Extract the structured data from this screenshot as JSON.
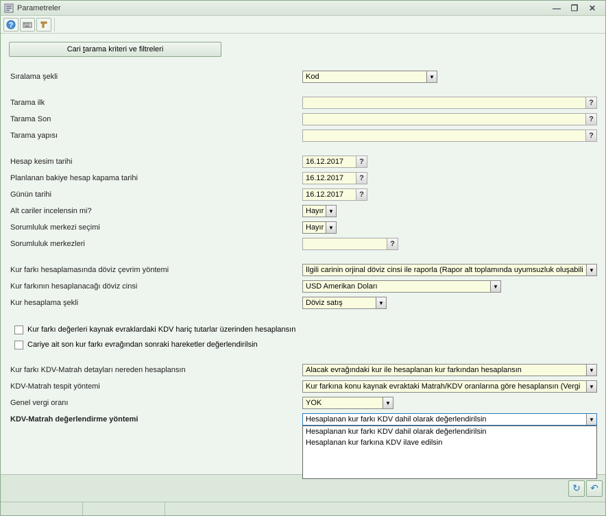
{
  "window": {
    "title": "Parametreler"
  },
  "buttons": {
    "filterBtn_pre": "Cari ",
    "filterBtn_u": "t",
    "filterBtn_post": "arama kriteri ve filtreleri"
  },
  "labels": {
    "sortType": "Sıralama şekli",
    "scanFirst": "Tarama ilk",
    "scanLast": "Tarama Son",
    "scanStruct": "Tarama yapısı",
    "accCutoff": "Hesap kesim tarihi",
    "plannedClose": "Planlanan bakiye hesap kapama tarihi",
    "todayDate": "Günün tarihi",
    "subAccounts": "Alt cariler incelensin mi?",
    "respCenterSel": "Sorumluluk merkezi seçimi",
    "respCenters": "Sorumluluk merkezleri",
    "fxConvMethod": "Kur farkı hesaplamasında döviz çevrim yöntemi",
    "fxCurrency": "Kur farkının hesaplanacağı döviz cinsi",
    "fxCalcType": "Kur hesaplama şekli",
    "chk1": "Kur farkı değerleri kaynak evraklardaki KDV hariç tutarlar üzerinden hesaplansın",
    "chk2": "Cariye ait son kur farkı evrağından sonraki hareketler değerlendirilsin",
    "kdvMatrahSrc": "Kur farkı KDV-Matrah detayları nereden hesaplansın",
    "kdvMatrahMethod": "KDV-Matrah tespit yöntemi",
    "generalTaxRate": "Genel vergi oranı",
    "kdvMatrahEval": "KDV-Matrah değerlendirme yöntemi"
  },
  "values": {
    "sortType": "Kod",
    "date1": "16.12.2017",
    "date2": "16.12.2017",
    "date3": "16.12.2017",
    "subAccounts": "Hayır",
    "respCenterSel": "Hayır",
    "fxConvMethod": "İlgili carinin orjinal döviz cinsi ile raporla (Rapor alt toplamında uyumsuzluk oluşabili",
    "fxCurrency": "USD Amerikan Doları",
    "fxCalcType": "Döviz satış",
    "kdvMatrahSrc": "Alacak evrağındaki kur ile hesaplanan kur farkından hesaplansın",
    "kdvMatrahMethod": "Kur farkına konu kaynak evraktaki Matrah/KDV oranlarına göre hesaplansın (Vergi",
    "generalTaxRate": "YOK",
    "kdvMatrahEval": "Hesaplanan kur farkı KDV dahil olarak değerlendirilsin"
  },
  "dropdownOptions": {
    "opt1": "Hesaplanan kur farkı KDV dahil olarak değerlendirilsin",
    "opt2": "Hesaplanan kur farkına KDV ilave edilsin"
  },
  "glyphs": {
    "help": "?",
    "down": "▼",
    "minimize": "—",
    "restore": "❐",
    "close": "✕",
    "refresh": "↻",
    "back": "↶"
  }
}
